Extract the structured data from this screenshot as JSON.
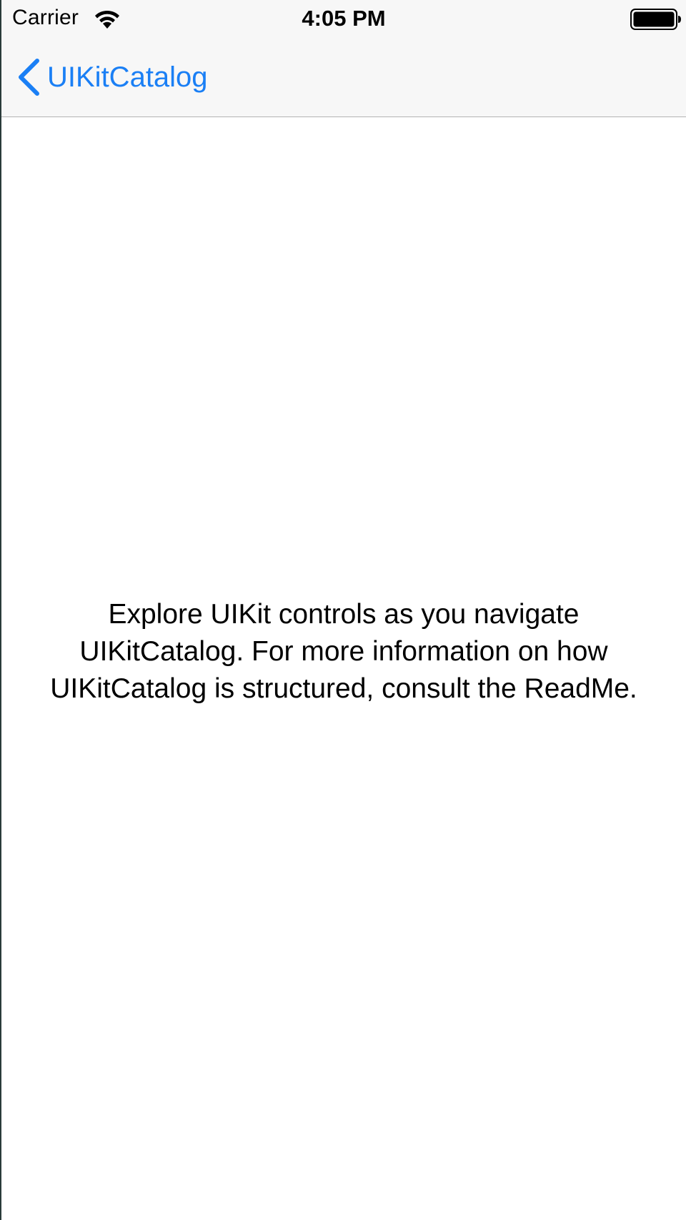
{
  "status_bar": {
    "carrier": "Carrier",
    "time": "4:05 PM",
    "wifi_icon": "wifi-icon",
    "battery_icon": "battery-icon"
  },
  "nav_bar": {
    "back_label": "UIKitCatalog",
    "back_icon": "chevron-left-icon"
  },
  "content": {
    "message": "Explore UIKit controls as you navigate UIKitCatalog. For more information on how UIKitCatalog is structured, consult the ReadMe."
  },
  "colors": {
    "accent": "#1a7ff5",
    "bar_background": "#f7f7f7",
    "text": "#000000"
  }
}
